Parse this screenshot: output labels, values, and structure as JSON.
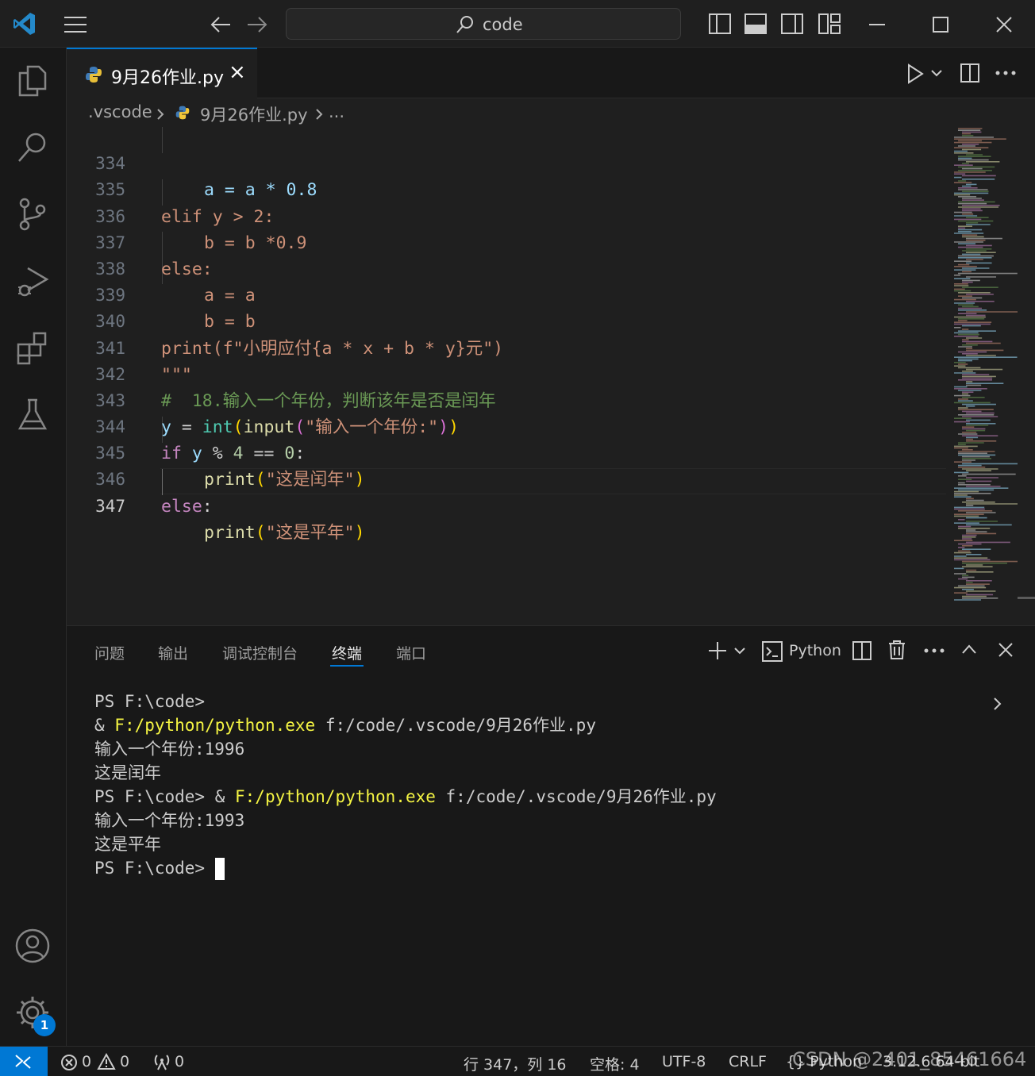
{
  "titlebar": {
    "search_text": "code",
    "icons": [
      "vscode-logo-icon",
      "menu-icon",
      "back-arrow-icon",
      "forward-arrow-icon",
      "search-icon",
      "toggle-primary-sidebar-icon",
      "toggle-panel-icon",
      "toggle-secondary-sidebar-icon",
      "customize-layout-icon",
      "minimize-icon",
      "maximize-icon",
      "close-icon"
    ]
  },
  "activitybar": {
    "items": [
      "explorer-icon",
      "search-icon",
      "source-control-icon",
      "run-debug-icon",
      "extensions-icon",
      "testing-icon"
    ],
    "bottom": [
      "accounts-icon",
      "manage-gear-icon"
    ],
    "badge": "1"
  },
  "tab": {
    "label": "9月26作业.py",
    "close": "×"
  },
  "breadcrumb": {
    "folder": ".vscode",
    "file": "9月26作业.py",
    "more": "..."
  },
  "editor": {
    "lines": [
      {
        "n": "334",
        "active": false
      },
      {
        "n": "335",
        "active": false
      },
      {
        "n": "336",
        "active": false
      },
      {
        "n": "337",
        "active": false
      },
      {
        "n": "338",
        "active": false
      },
      {
        "n": "339",
        "active": false
      },
      {
        "n": "340",
        "active": false
      },
      {
        "n": "341",
        "active": false
      },
      {
        "n": "342",
        "active": false
      },
      {
        "n": "343",
        "active": false
      },
      {
        "n": "344",
        "active": false
      },
      {
        "n": "345",
        "active": false
      },
      {
        "n": "346",
        "active": false
      },
      {
        "n": "347",
        "active": true
      }
    ],
    "code": {
      "l334": [
        "a = a * 0.8"
      ],
      "l335": [
        "elif y > 2:"
      ],
      "l336": [
        "b = b *0.9"
      ],
      "l337": [
        "else:"
      ],
      "l338": [
        "a = a"
      ],
      "l339": [
        "b = b"
      ],
      "l340": [
        "print(f\"小明应付{a * x + b * y}元\")"
      ],
      "l341": [
        "\"\"\""
      ],
      "l342": [
        "#  18.输入一个年份，判断该年是否是闰年"
      ],
      "l343_y": "y",
      "l343_eq": " = ",
      "l343_int": "int",
      "l343_p1": "(",
      "l343_input": "input",
      "l343_p2": "(",
      "l343_str": "\"输入一个年份:\"",
      "l343_p3": ")",
      "l343_p4": ")",
      "l344_if": "if",
      "l344_y": " y",
      "l344_op": " % ",
      "l344_4": "4",
      "l344_eq": " == ",
      "l344_0": "0",
      "l344_colon": ":",
      "l345_print": "print",
      "l345_p1": "(",
      "l345_str": "\"这是闰年\"",
      "l345_p2": ")",
      "l346_else": "else",
      "l346_colon": ":",
      "l347_print": "print",
      "l347_p1": "(",
      "l347_str": "\"这是平年\"",
      "l347_p2": ")"
    }
  },
  "panel": {
    "tabs": [
      "问题",
      "输出",
      "调试控制台",
      "终端",
      "端口"
    ],
    "active_tab": "终端",
    "terminal_profile": "Python",
    "terminal": {
      "l1": "PS F:\\code>",
      "l2_amp": "& ",
      "l2_exe": "F:/python/python.exe",
      "l2_arg": " f:/code/.vscode/9月26作业.py",
      "l3": "输入一个年份:1996",
      "l4": "这是闰年",
      "l5_ps": "PS F:\\code> & ",
      "l5_exe": "F:/python/python.exe",
      "l5_arg": " f:/code/.vscode/9月26作业.py",
      "l6": "输入一个年份:1993",
      "l7": "这是平年",
      "l8": "PS F:\\code> "
    }
  },
  "statusbar": {
    "errors": "0",
    "warnings": "0",
    "ports": "0",
    "position": "行 347，列 16",
    "spaces": "空格: 4",
    "encoding": "UTF-8",
    "eol": "CRLF",
    "language": "{} Python",
    "interpreter": "3.12.6 64-bit",
    "watermark": "CSDN @2401_85461664"
  },
  "colors": {
    "accent": "#0078d4",
    "background": "#1f1f1f",
    "sidebar": "#181818"
  }
}
